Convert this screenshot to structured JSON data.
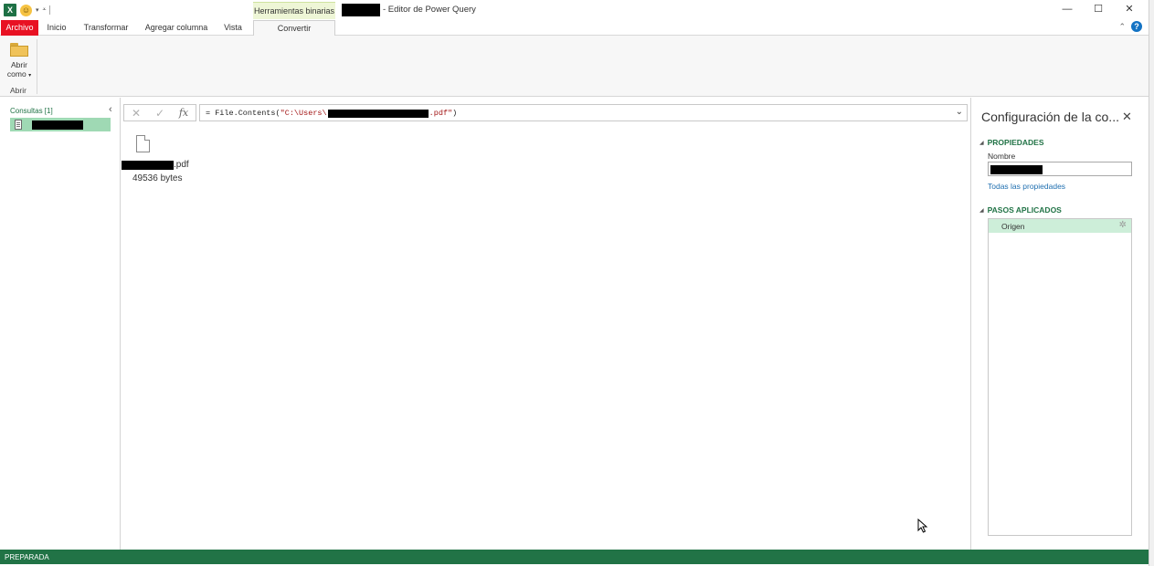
{
  "title_bar": {
    "app_icon": "excel-icon",
    "context_group_label": "Herramientas binarias",
    "window_title": "- Editor de Power Query",
    "controls": {
      "minimize": "—",
      "maximize": "☐",
      "close": "✕"
    }
  },
  "tabs": {
    "items": [
      "Archivo",
      "Inicio",
      "Transformar",
      "Agregar columna",
      "Vista",
      "Convertir"
    ],
    "active": "Convertir",
    "help": "?"
  },
  "ribbon": {
    "open_as_line1": "Abrir",
    "open_as_line2": "como",
    "group_label": "Abrir"
  },
  "left_pane": {
    "header": "Consultas [1]"
  },
  "formula_bar": {
    "cancel": "✕",
    "commit": "✓",
    "fx": "fx",
    "prefix": "= File.Contents(",
    "path_start": "\"C:\\Users\\",
    "path_end": ".pdf\"",
    "suffix": ")"
  },
  "preview": {
    "file_ext": ".pdf",
    "file_size": "49536 bytes"
  },
  "right_pane": {
    "title": "Configuración de la co...",
    "properties_header": "PROPIEDADES",
    "name_label": "Nombre",
    "all_properties_link": "Todas las propiedades",
    "steps_header": "PASOS APLICADOS",
    "steps": [
      "Origen"
    ]
  },
  "status_bar": {
    "text": "PREPARADA"
  },
  "colors": {
    "accent_green": "#217346",
    "archivo_red": "#e81123",
    "selected_query": "#9fd9b4",
    "selected_step": "#cdeed9"
  }
}
